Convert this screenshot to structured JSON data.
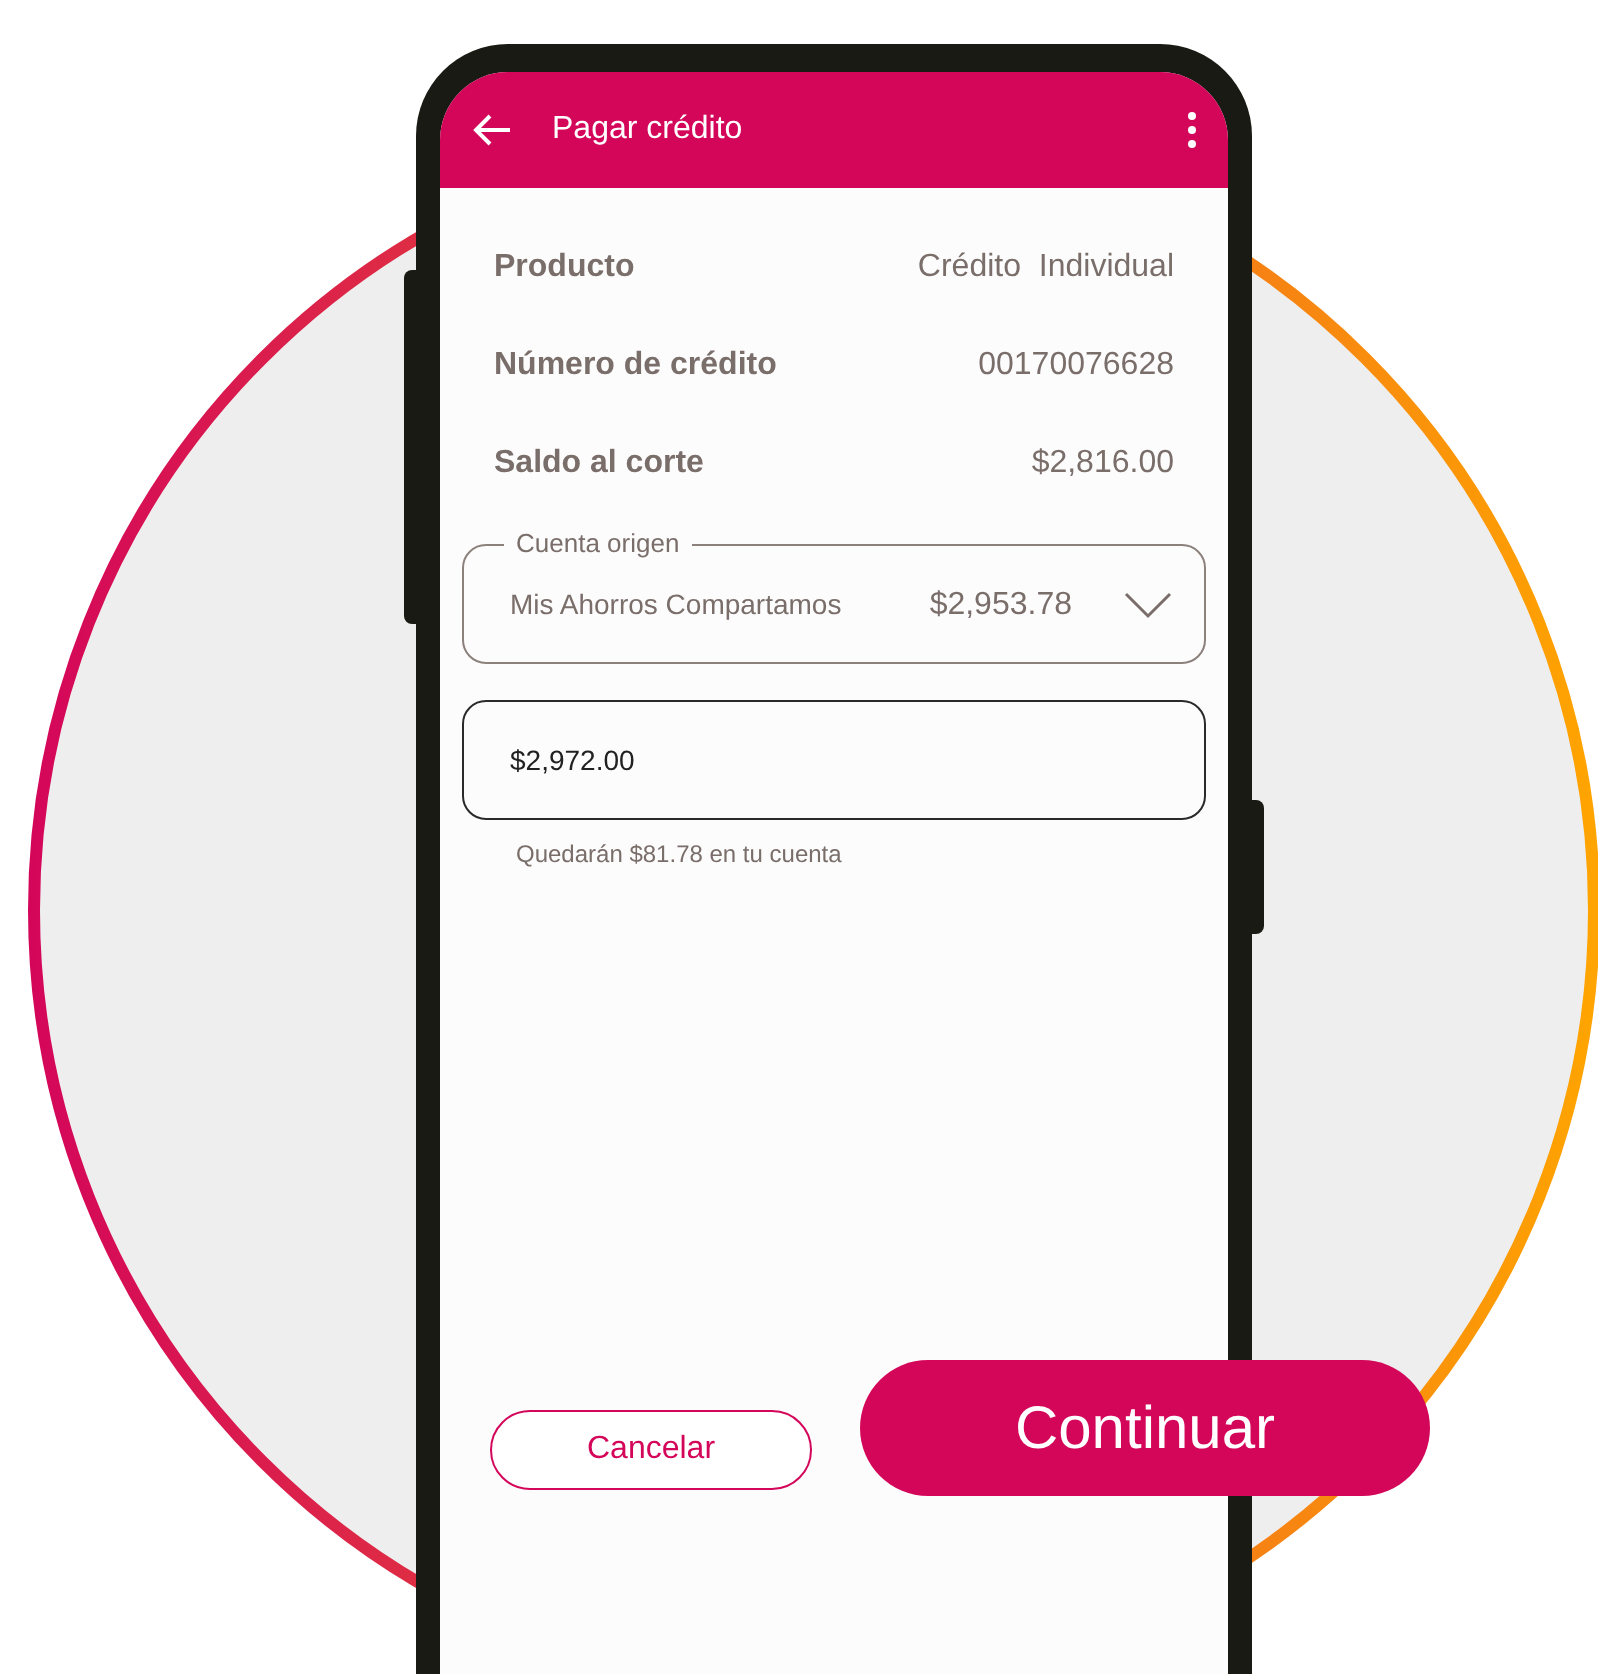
{
  "header": {
    "title": "Pagar crédito"
  },
  "details": [
    {
      "label": "Producto",
      "value": "Crédito  Individual"
    },
    {
      "label": "Número de crédito",
      "value": "00170076628"
    },
    {
      "label": "Saldo al corte",
      "value": "$2,816.00"
    }
  ],
  "account_select": {
    "label": "Cuenta origen",
    "account": "Mis Ahorros Compartamos",
    "balance": "$2,953.78"
  },
  "amount_field": {
    "value": "$2,972.00"
  },
  "hint": "Quedarán $81.78 en tu cuenta",
  "buttons": [
    {
      "label": "Cancelar",
      "kind": "secondary"
    },
    {
      "label": "Continuar",
      "kind": "primary"
    }
  ]
}
